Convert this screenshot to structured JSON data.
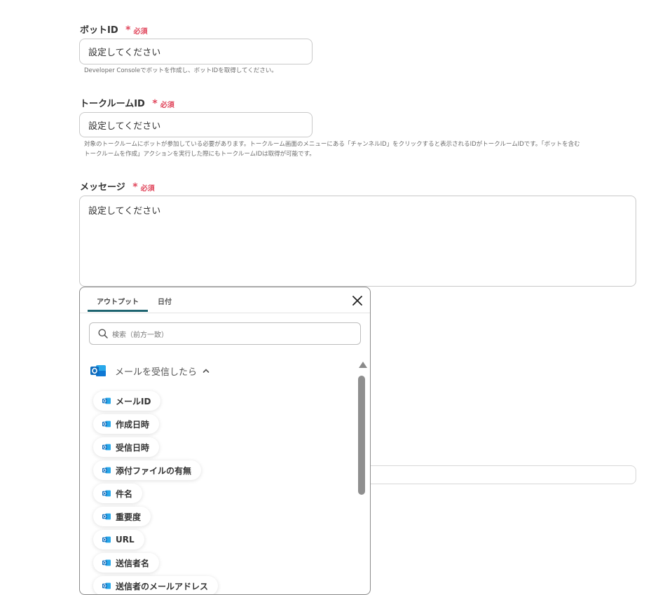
{
  "form": {
    "bot_id": {
      "label": "ボットID",
      "required": "必須",
      "placeholder": "設定してください",
      "help": "Developer Consoleでボットを作成し、ボットIDを取得してください。"
    },
    "talkroom_id": {
      "label": "トークルームID",
      "required": "必須",
      "placeholder": "設定してください",
      "help_line1": "対象のトークルームにボットが参加している必要があります。トークルーム画面のメニューにある「チャンネルID」をクリックすると表示されるIDがトークルームIDです。「ボットを含む",
      "help_line2": "トークルームを作成」アクションを実行した際にもトークルームIDは取得が可能です。"
    },
    "message": {
      "label": "メッセージ",
      "required": "必須",
      "placeholder": "設定してください"
    }
  },
  "popover": {
    "tabs": [
      "アウトプット",
      "日付"
    ],
    "active_tab": "アウトプット",
    "search_placeholder": "検索（前方一致）",
    "group": {
      "title": "メールを受信したら",
      "icon": "outlook-icon",
      "items": [
        "メールID",
        "作成日時",
        "受信日時",
        "添付ファイルの有無",
        "件名",
        "重要度",
        "URL",
        "送信者名",
        "送信者のメールアドレス"
      ]
    }
  },
  "colors": {
    "required": "#e0445a",
    "tab_accent": "#1e6470",
    "outlook_blue": "#0f6cbd"
  }
}
